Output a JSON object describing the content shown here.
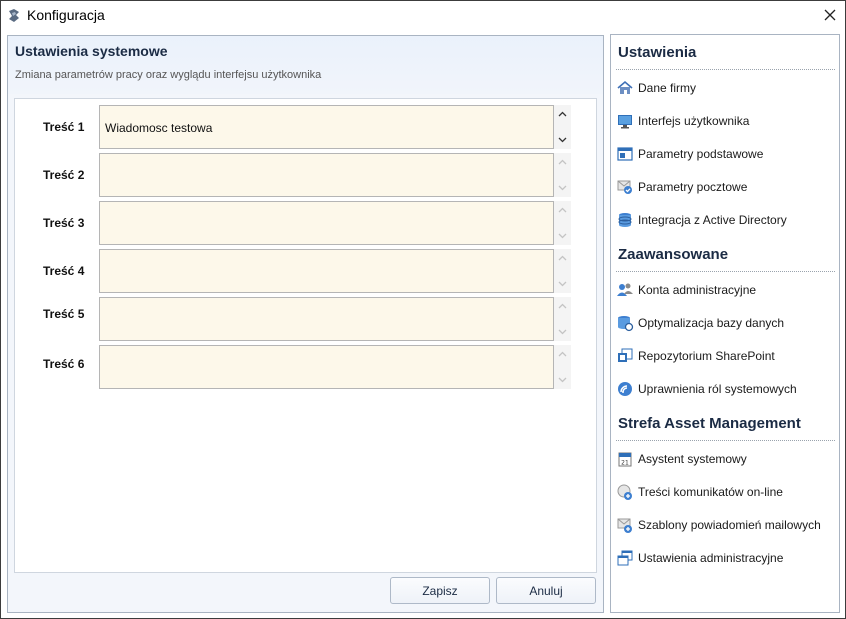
{
  "window": {
    "title": "Konfiguracja"
  },
  "main": {
    "title": "Ustawienia systemowe",
    "subtitle": "Zmiana parametrów pracy oraz wyglądu interfejsu użytkownika",
    "fields": [
      {
        "label": "Treść 1",
        "value": "Wiadomosc testowa"
      },
      {
        "label": "Treść 2",
        "value": ""
      },
      {
        "label": "Treść 3",
        "value": ""
      },
      {
        "label": "Treść 4",
        "value": ""
      },
      {
        "label": "Treść 5",
        "value": ""
      },
      {
        "label": "Treść 6",
        "value": ""
      }
    ],
    "save_label": "Zapisz",
    "cancel_label": "Anuluj"
  },
  "sidebar": {
    "sections": [
      {
        "title": "Ustawienia",
        "items": [
          {
            "label": "Dane firmy",
            "icon": "house-icon"
          },
          {
            "label": "Interfejs użytkownika",
            "icon": "monitor-icon"
          },
          {
            "label": "Parametry podstawowe",
            "icon": "window-icon"
          },
          {
            "label": "Parametry pocztowe",
            "icon": "mail-check-icon"
          },
          {
            "label": "Integracja z Active Directory",
            "icon": "database-icon"
          }
        ]
      },
      {
        "title": "Zaawansowane",
        "items": [
          {
            "label": "Konta administracyjne",
            "icon": "users-icon"
          },
          {
            "label": "Optymalizacja bazy danych",
            "icon": "database-gear-icon"
          },
          {
            "label": "Repozytorium SharePoint",
            "icon": "sharepoint-icon"
          },
          {
            "label": "Uprawnienia ról systemowych",
            "icon": "roles-icon"
          }
        ]
      },
      {
        "title": "Strefa Asset Management",
        "items": [
          {
            "label": "Asystent systemowy",
            "icon": "calendar-icon"
          },
          {
            "label": "Treści komunikatów on-line",
            "icon": "message-add-icon"
          },
          {
            "label": "Szablony powiadomień mailowych",
            "icon": "mail-add-icon"
          },
          {
            "label": "Ustawienia administracyjne",
            "icon": "windows-stack-icon"
          }
        ]
      }
    ]
  },
  "colors": {
    "accent": "#1b2b44",
    "input_bg": "#fdf8ea",
    "panel_bg": "#f3f6fb"
  }
}
